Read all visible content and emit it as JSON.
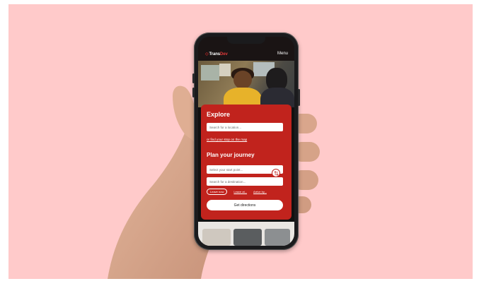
{
  "header": {
    "logo_prefix": "Trans",
    "logo_accent": "Dev",
    "menu_label": "Menu"
  },
  "explore": {
    "title": "Explore",
    "search_placeholder": "Search for a location...",
    "map_link": "or find your stop on the map"
  },
  "journey": {
    "title": "Plan your journey",
    "start_placeholder": "Select your start point...",
    "destination_placeholder": "Search for a destination...",
    "leave_now": "Leave now",
    "leave_at": "Leave at...",
    "arrive_by": "Arrive by...",
    "cta": "Get directions"
  },
  "colors": {
    "background": "#ffcaca",
    "brand_red": "#c1231d",
    "phone_frame": "#1b1b1d"
  },
  "icons": {
    "swap": "swap-vertical-icon",
    "logo": "transdev-logo-icon"
  }
}
